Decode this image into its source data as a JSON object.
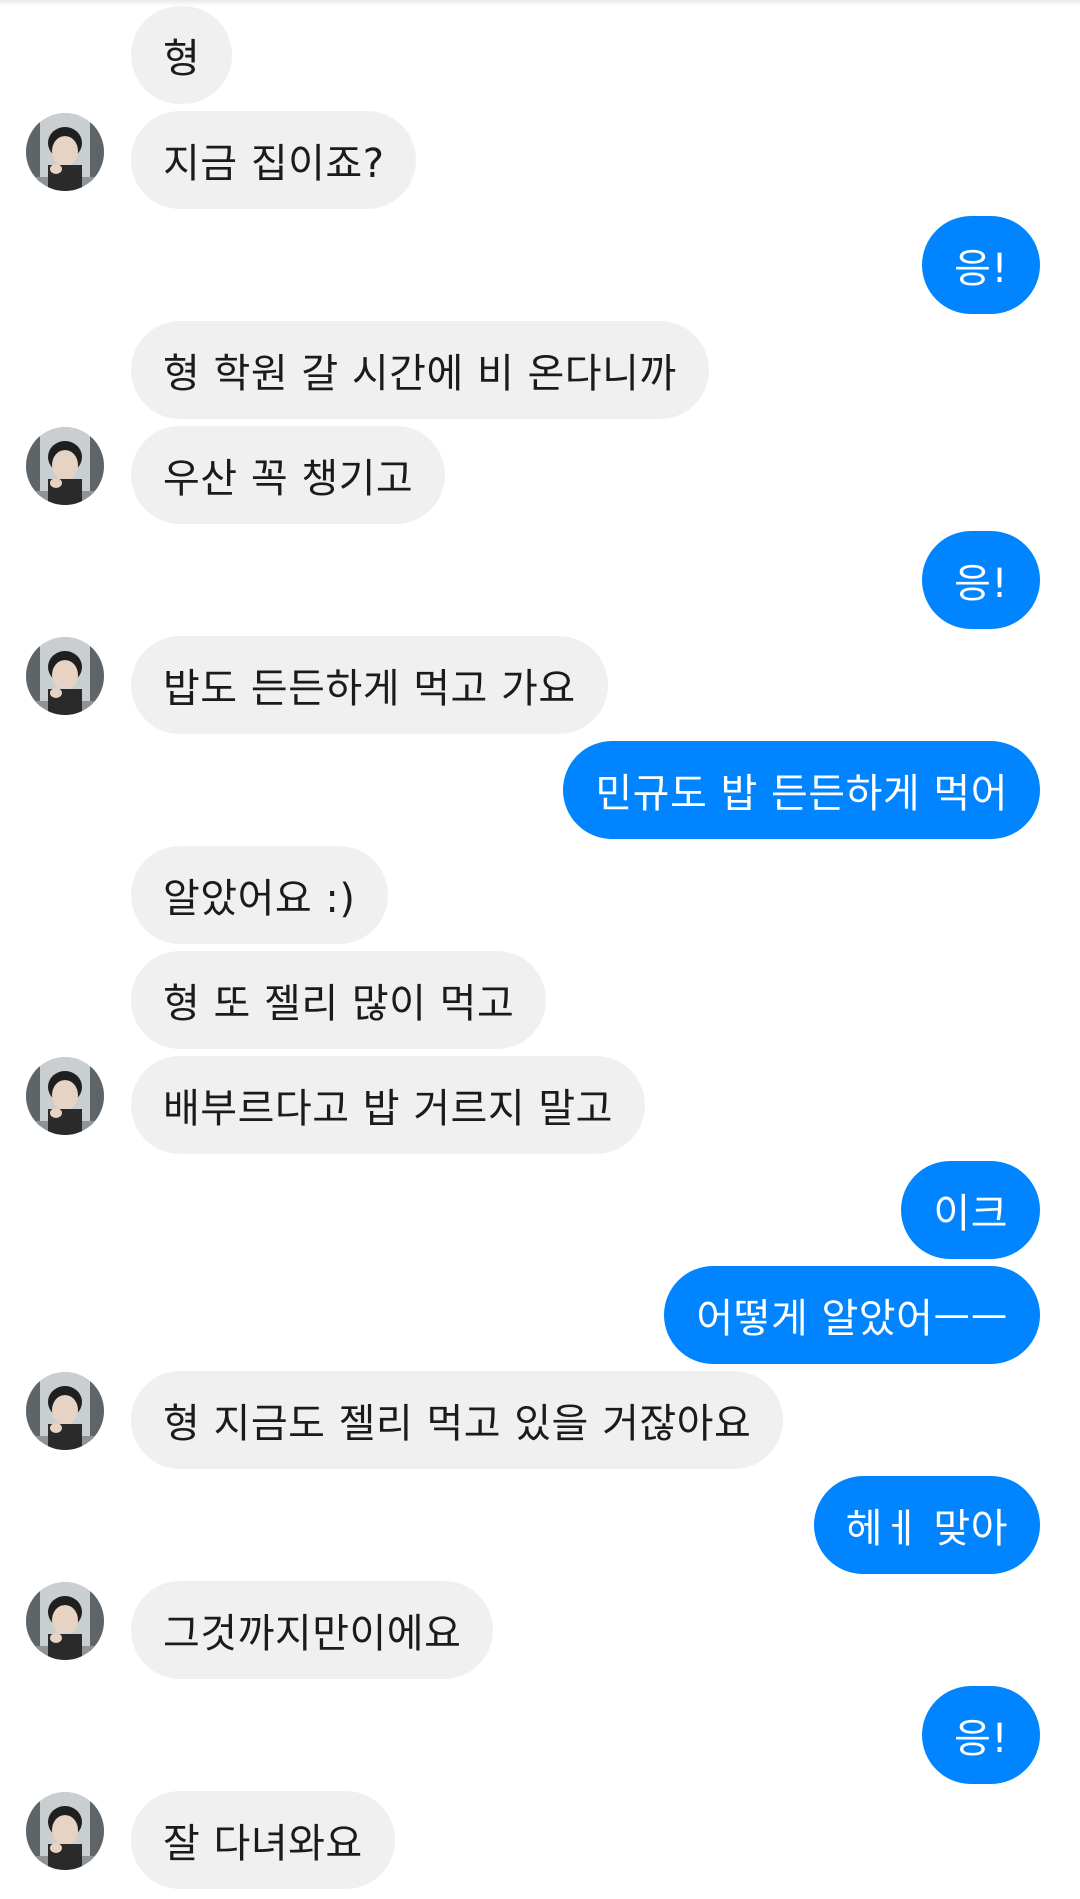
{
  "conversation": {
    "messages": [
      {
        "from": "them",
        "text": "형"
      },
      {
        "from": "them",
        "text": "지금 집이죠?"
      },
      {
        "from": "me",
        "text": "응!"
      },
      {
        "from": "them",
        "text": "형 학원 갈 시간에 비 온다니까"
      },
      {
        "from": "them",
        "text": "우산 꼭 챙기고"
      },
      {
        "from": "me",
        "text": "응!"
      },
      {
        "from": "them",
        "text": "밥도 든든하게 먹고 가요"
      },
      {
        "from": "me",
        "text": "민규도 밥 든든하게 먹어"
      },
      {
        "from": "them",
        "text": "알았어요 :)"
      },
      {
        "from": "them",
        "text": "형 또 젤리 많이 먹고"
      },
      {
        "from": "them",
        "text": "배부르다고 밥 거르지 말고"
      },
      {
        "from": "me",
        "text": "이크"
      },
      {
        "from": "me",
        "text": "어떻게 알았어ㅡㅡ"
      },
      {
        "from": "them",
        "text": "형 지금도 젤리 먹고 있을 거잖아요"
      },
      {
        "from": "me",
        "text": "헤ㅔ 맞아"
      },
      {
        "from": "them",
        "text": "그것까지만이에요"
      },
      {
        "from": "me",
        "text": "응!"
      },
      {
        "from": "them",
        "text": "잘 다녀와요"
      }
    ]
  },
  "colors": {
    "outgoing_bubble": "#0084ff",
    "incoming_bubble": "#f0f0f0",
    "background": "#ffffff"
  },
  "icons": {
    "avatar": "contact-avatar-photo"
  }
}
